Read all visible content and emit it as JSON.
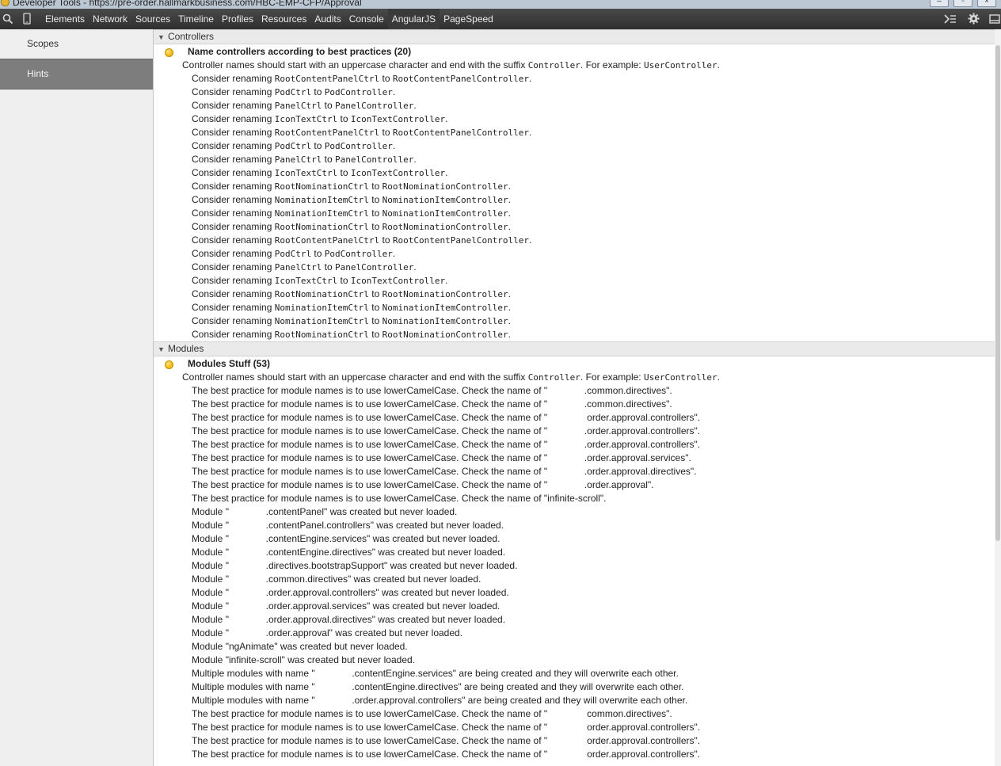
{
  "window": {
    "title": "Developer Tools - https://pre-order.hallmarkbusiness.com/HBC-EMP-CFP/Approval"
  },
  "toolbar": {
    "tabs": [
      "Elements",
      "Network",
      "Sources",
      "Timeline",
      "Profiles",
      "Resources",
      "Audits",
      "Console",
      "AngularJS",
      "PageSpeed"
    ],
    "active_tab": "AngularJS"
  },
  "sidebar": {
    "items": [
      {
        "label": "Scopes",
        "active": false
      },
      {
        "label": "Hints",
        "active": true
      }
    ]
  },
  "sections": [
    {
      "header": "Controllers",
      "hint_title": "Name controllers according to best practices (20)",
      "description": {
        "pre": "Controller names should start with an uppercase character and end with the suffix ",
        "code1": "Controller",
        "mid": ". For example: ",
        "code2": "UserController",
        "post": "."
      },
      "rows": [
        [
          "Consider renaming ",
          "RootContentPanelCtrl",
          " to ",
          "RootContentPanelController",
          "."
        ],
        [
          "Consider renaming ",
          "PodCtrl",
          " to ",
          "PodController",
          "."
        ],
        [
          "Consider renaming ",
          "PanelCtrl",
          " to ",
          "PanelController",
          "."
        ],
        [
          "Consider renaming ",
          "IconTextCtrl",
          " to ",
          "IconTextController",
          "."
        ],
        [
          "Consider renaming ",
          "RootContentPanelCtrl",
          " to ",
          "RootContentPanelController",
          "."
        ],
        [
          "Consider renaming ",
          "PodCtrl",
          " to ",
          "PodController",
          "."
        ],
        [
          "Consider renaming ",
          "PanelCtrl",
          " to ",
          "PanelController",
          "."
        ],
        [
          "Consider renaming ",
          "IconTextCtrl",
          " to ",
          "IconTextController",
          "."
        ],
        [
          "Consider renaming ",
          "RootNominationCtrl",
          " to ",
          "RootNominationController",
          "."
        ],
        [
          "Consider renaming ",
          "NominationItemCtrl",
          " to ",
          "NominationItemController",
          "."
        ],
        [
          "Consider renaming ",
          "NominationItemCtrl",
          " to ",
          "NominationItemController",
          "."
        ],
        [
          "Consider renaming ",
          "RootNominationCtrl",
          " to ",
          "RootNominationController",
          "."
        ],
        [
          "Consider renaming ",
          "RootContentPanelCtrl",
          " to ",
          "RootContentPanelController",
          "."
        ],
        [
          "Consider renaming ",
          "PodCtrl",
          " to ",
          "PodController",
          "."
        ],
        [
          "Consider renaming ",
          "PanelCtrl",
          " to ",
          "PanelController",
          "."
        ],
        [
          "Consider renaming ",
          "IconTextCtrl",
          " to ",
          "IconTextController",
          "."
        ],
        [
          "Consider renaming ",
          "RootNominationCtrl",
          " to ",
          "RootNominationController",
          "."
        ],
        [
          "Consider renaming ",
          "NominationItemCtrl",
          " to ",
          "NominationItemController",
          "."
        ],
        [
          "Consider renaming ",
          "NominationItemCtrl",
          " to ",
          "NominationItemController",
          "."
        ],
        [
          "Consider renaming ",
          "RootNominationCtrl",
          " to ",
          "RootNominationController",
          "."
        ]
      ]
    },
    {
      "header": "Modules",
      "hint_title": "Modules Stuff (53)",
      "description": {
        "pre": "Controller names should start with an uppercase character and end with the suffix ",
        "code1": "Controller",
        "mid": ". For example: ",
        "code2": "UserController",
        "post": "."
      },
      "lines": [
        "The best practice for module names is to use lowerCamelCase. Check the name of \"              .common.directives\".",
        "The best practice for module names is to use lowerCamelCase. Check the name of \"              .common.directives\".",
        "The best practice for module names is to use lowerCamelCase. Check the name of \"               order.approval.controllers\".",
        "The best practice for module names is to use lowerCamelCase. Check the name of \"              .order.approval.controllers\".",
        "The best practice for module names is to use lowerCamelCase. Check the name of \"              .order.approval.controllers\".",
        "The best practice for module names is to use lowerCamelCase. Check the name of \"              .order.approval.services\".",
        "The best practice for module names is to use lowerCamelCase. Check the name of \"              .order.approval.directives\".",
        "The best practice for module names is to use lowerCamelCase. Check the name of \"              .order.approval\".",
        "The best practice for module names is to use lowerCamelCase. Check the name of \"infinite-scroll\".",
        "Module \"              .contentPanel\" was created but never loaded.",
        "Module \"              .contentPanel.controllers\" was created but never loaded.",
        "Module \"              .contentEngine.services\" was created but never loaded.",
        "Module \"              .contentEngine.directives\" was created but never loaded.",
        "Module \"              .directives.bootstrapSupport\" was created but never loaded.",
        "Module \"              .common.directives\" was created but never loaded.",
        "Module \"              .order.approval.controllers\" was created but never loaded.",
        "Module \"              .order.approval.services\" was created but never loaded.",
        "Module \"              .order.approval.directives\" was created but never loaded.",
        "Module \"              .order.approval\" was created but never loaded.",
        "Module \"ngAnimate\" was created but never loaded.",
        "Module \"infinite-scroll\" was created but never loaded.",
        "Multiple modules with name \"              .contentEngine.services\" are being created and they will overwrite each other.",
        "Multiple modules with name \"              .contentEngine.directives\" are being created and they will overwrite each other.",
        "Multiple modules with name \"              .order.approval.controllers\" are being created and they will overwrite each other.",
        "The best practice for module names is to use lowerCamelCase. Check the name of \"               common.directives\".",
        "The best practice for module names is to use lowerCamelCase. Check the name of \"               order.approval.controllers\".",
        "The best practice for module names is to use lowerCamelCase. Check the name of \"               order.approval.controllers\".",
        "The best practice for module names is to use lowerCamelCase. Check the name of \"               order.approval.controllers\"."
      ]
    }
  ],
  "colors": {
    "toolbar_bg": "#3a3a3a",
    "sidebar_active": "#7d7d7d",
    "hint_dot": "#f0b400"
  }
}
